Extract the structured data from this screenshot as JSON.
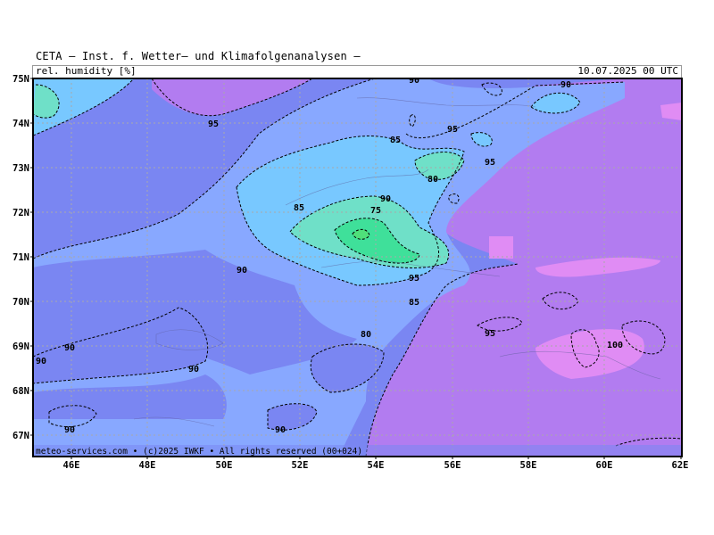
{
  "header": {
    "title": "CETA — Inst. f. Wetter— und Klimafolgenanalysen —",
    "field_label": "rel. humidity [%]",
    "valid_time": "10.07.2025 00 UTC"
  },
  "footer": {
    "credit": "meteo-services.com • (c)2025 IWKF • All rights reserved (00+024)"
  },
  "axes": {
    "lat_ticks": [
      "75N",
      "74N",
      "73N",
      "72N",
      "71N",
      "70N",
      "69N",
      "68N",
      "67N"
    ],
    "lon_ticks": [
      "46E",
      "48E",
      "50E",
      "52E",
      "54E",
      "56E",
      "58E",
      "60E",
      "62E"
    ]
  },
  "contour_labels": [
    "95",
    "90",
    "85",
    "80",
    "75",
    "95",
    "90",
    "85",
    "95",
    "90",
    "95",
    "90",
    "85",
    "80",
    "90",
    "90",
    "90",
    "95",
    "100",
    "90",
    "90"
  ],
  "colors": {
    "rh_75": "#3fe09a",
    "rh_80": "#6fe0c8",
    "rh_85": "#78c8ff",
    "rh_90": "#88a8ff",
    "rh_95": "#7a86f2",
    "rh_100": "#b27cf0",
    "rh_100_plus": "#e08cf4"
  }
}
